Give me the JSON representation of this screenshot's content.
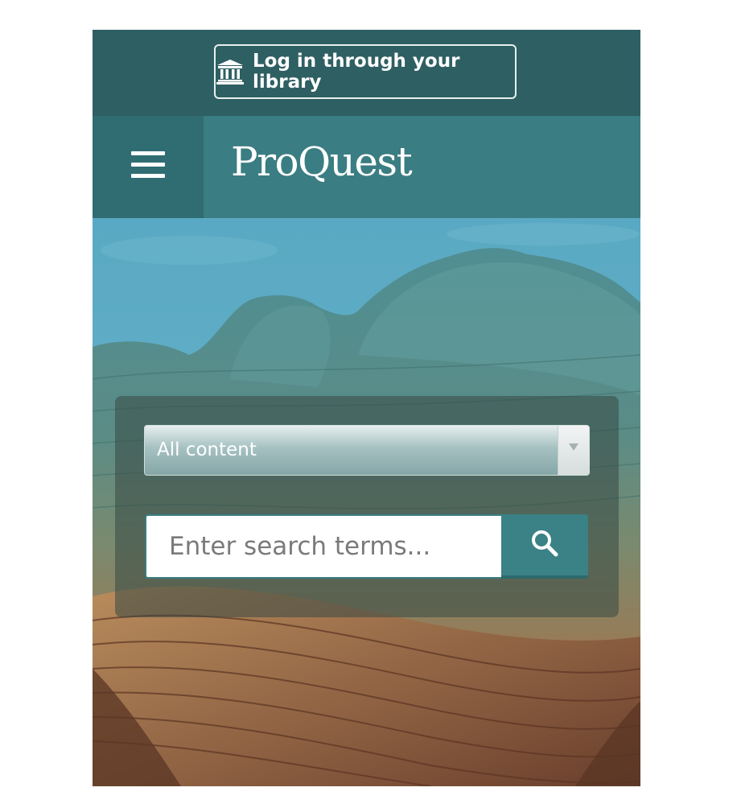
{
  "topbar": {
    "login_label": "Log in through your library",
    "login_icon": "institution-icon"
  },
  "header": {
    "menu_icon": "hamburger-menu-icon",
    "logo_text": "ProQuest"
  },
  "search": {
    "content_select": {
      "selected": "All content"
    },
    "input_placeholder": "Enter search terms...",
    "input_value": "",
    "button_icon": "search-icon"
  },
  "colors": {
    "topbar": "#2e5f63",
    "header": "#3a7d82",
    "menu_button": "#2f6d72",
    "search_button": "#3a8286"
  }
}
